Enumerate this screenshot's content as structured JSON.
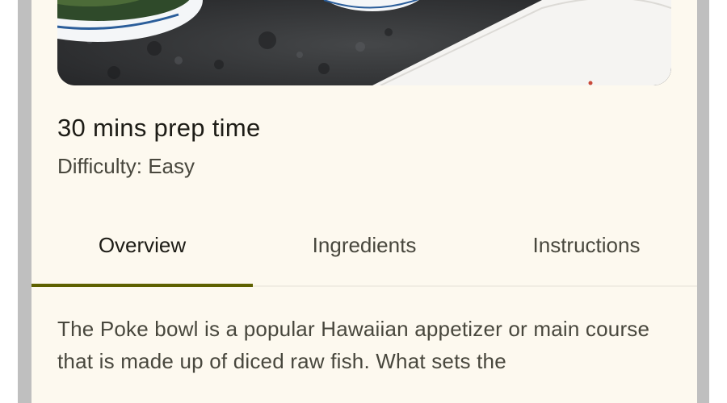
{
  "recipe": {
    "prep_time": "30 mins prep time",
    "difficulty": "Difficulty: Easy",
    "description": "The Poke bowl is a popular Hawaiian appetizer or main course that is made up of diced raw fish. What sets the"
  },
  "tabs": [
    {
      "label": "Overview",
      "selected": true
    },
    {
      "label": "Ingredients",
      "selected": false
    },
    {
      "label": "Instructions",
      "selected": false
    }
  ],
  "colors": {
    "surface": "#fdf9ef",
    "indicator": "#5e6100",
    "text_primary": "#1d1c16",
    "text_secondary": "#48473d",
    "scrim": "#bfbfbf"
  }
}
